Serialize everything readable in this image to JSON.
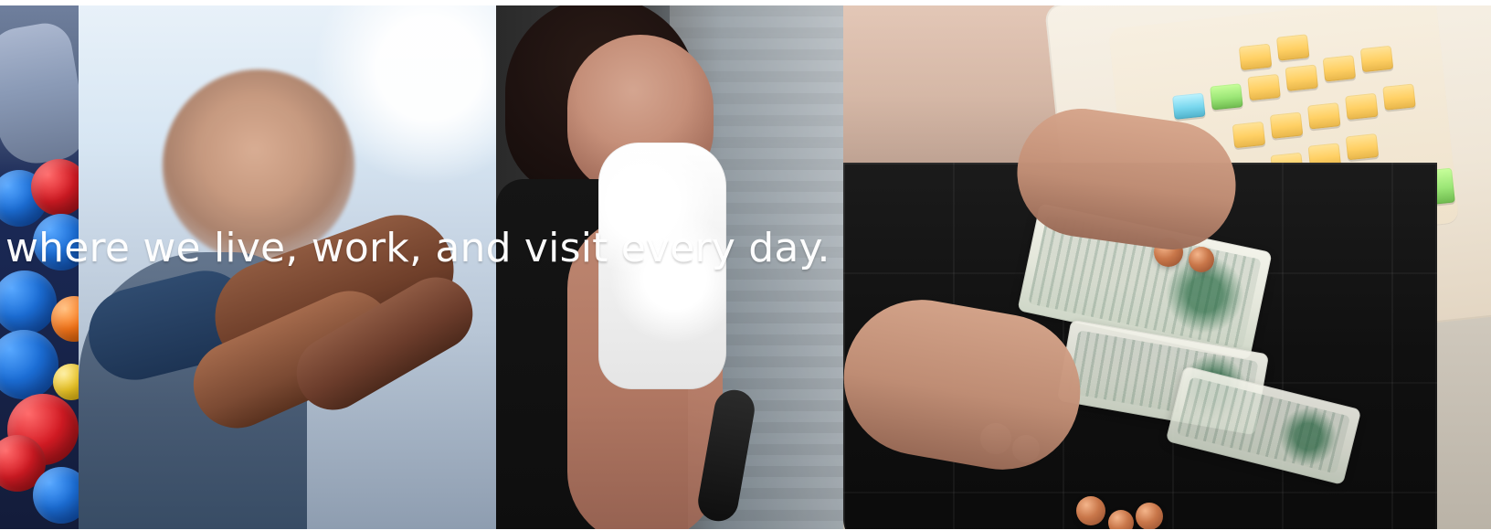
{
  "banner": {
    "caption": "where we live, work, and visit every day."
  },
  "images": [
    {
      "name": "colorful-balls-photo"
    },
    {
      "name": "handshake-photo"
    },
    {
      "name": "gym-woman-towel-photo"
    },
    {
      "name": "cash-register-photo"
    }
  ]
}
